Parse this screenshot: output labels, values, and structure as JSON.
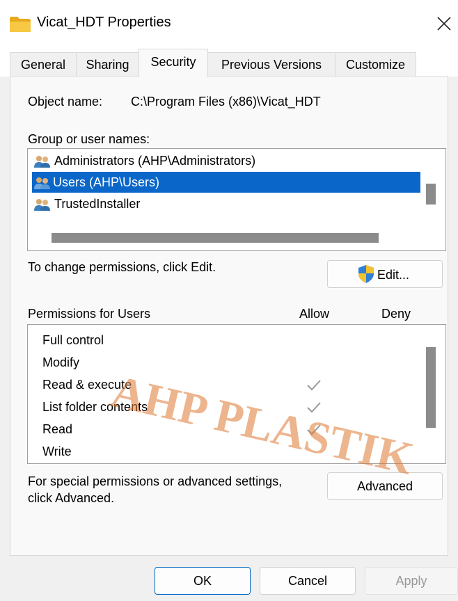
{
  "window": {
    "title": "Vicat_HDT Properties",
    "close_glyph": "✕"
  },
  "tabs": [
    {
      "label": "General",
      "active": false
    },
    {
      "label": "Sharing",
      "active": false
    },
    {
      "label": "Security",
      "active": true
    },
    {
      "label": "Previous Versions",
      "active": false
    },
    {
      "label": "Customize",
      "active": false
    }
  ],
  "security": {
    "object_name_label": "Object name:",
    "object_name_value": "C:\\Program Files (x86)\\Vicat_HDT",
    "group_label": "Group or user names:",
    "users": [
      {
        "name": "Administrators (AHP\\Administrators)",
        "selected": false,
        "icon": "users-icon"
      },
      {
        "name": "Users (AHP\\Users)",
        "selected": true,
        "icon": "users-icon"
      },
      {
        "name": "TrustedInstaller",
        "selected": false,
        "icon": "users-icon"
      }
    ],
    "change_hint": "To change permissions, click Edit.",
    "edit_label": "Edit...",
    "edit_icon": "uac-shield-icon",
    "permissions_label": "Permissions for Users",
    "allow_header": "Allow",
    "deny_header": "Deny",
    "permissions": [
      {
        "name": "Full control",
        "allow": false,
        "deny": false
      },
      {
        "name": "Modify",
        "allow": false,
        "deny": false
      },
      {
        "name": "Read & execute",
        "allow": true,
        "deny": false
      },
      {
        "name": "List folder contents",
        "allow": true,
        "deny": false
      },
      {
        "name": "Read",
        "allow": true,
        "deny": false
      },
      {
        "name": "Write",
        "allow": false,
        "deny": false
      }
    ],
    "advanced_hint_line1": "For special permissions or advanced settings,",
    "advanced_hint_line2": "click Advanced.",
    "advanced_label": "Advanced"
  },
  "footer": {
    "ok_label": "OK",
    "cancel_label": "Cancel",
    "apply_label": "Apply"
  },
  "watermark": {
    "text": "AHP PLASTIK"
  },
  "colors": {
    "selection": "#0a67c9",
    "folder": "#f4c12f",
    "check": "#9a9a9a",
    "watermark": "#de7832"
  }
}
